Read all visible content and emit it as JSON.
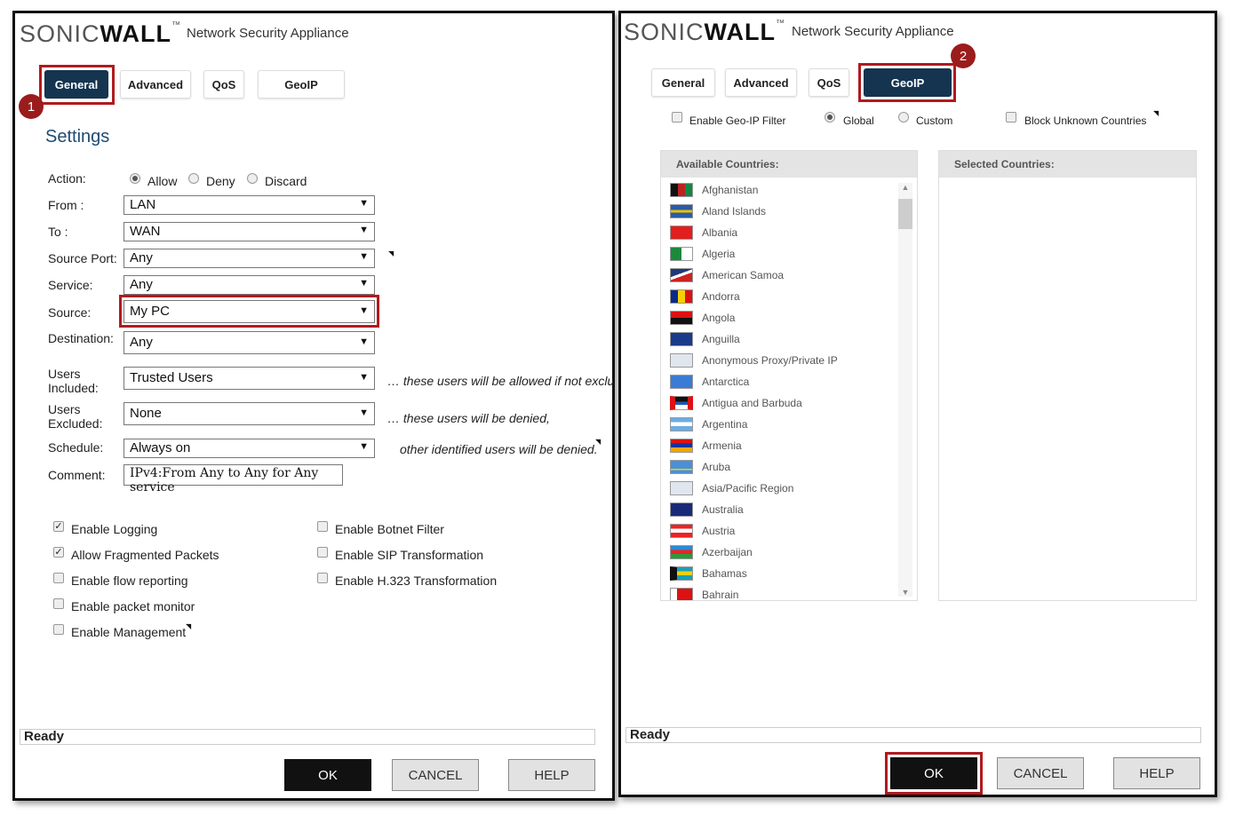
{
  "left": {
    "logo": {
      "sonic": "SONIC",
      "wall": "WALL",
      "tm": "™"
    },
    "app_name": "Network Security Appliance",
    "tabs": [
      "General",
      "Advanced",
      "QoS",
      "GeoIP"
    ],
    "badge": "1",
    "settings_title": "Settings",
    "action_label": "Action:",
    "action_options": [
      "Allow",
      "Deny",
      "Discard"
    ],
    "fields": {
      "from": {
        "label": "From :",
        "value": "LAN"
      },
      "to": {
        "label": "To :",
        "value": "WAN"
      },
      "source_port": {
        "label": "Source Port:",
        "value": "Any"
      },
      "service": {
        "label": "Service:",
        "value": "Any"
      },
      "source": {
        "label": "Source:",
        "value": "My PC"
      },
      "destination": {
        "label": "Destination:",
        "value": "Any"
      },
      "users_included": {
        "label1": "Users",
        "label2": "Included:",
        "value": "Trusted Users",
        "note": "… these users will be allowed if not excluded"
      },
      "users_excluded": {
        "label1": "Users",
        "label2": "Excluded:",
        "value": "None",
        "note": "… these users will be denied,"
      },
      "schedule": {
        "label": "Schedule:",
        "value": "Always on",
        "note": "other identified users will be denied."
      },
      "comment": {
        "label": "Comment:",
        "value": "IPv4:From Any to Any for Any service"
      }
    },
    "checkboxes_left": [
      "Enable Logging",
      "Allow Fragmented Packets",
      "Enable flow reporting",
      "Enable packet monitor",
      "Enable Management"
    ],
    "checkboxes_right": [
      "Enable Botnet Filter",
      "Enable SIP Transformation",
      "Enable H.323 Transformation"
    ],
    "status": "Ready",
    "buttons": {
      "ok": "OK",
      "cancel": "CANCEL",
      "help": "HELP"
    }
  },
  "right": {
    "logo": {
      "sonic": "SONIC",
      "wall": "WALL",
      "tm": "™"
    },
    "app_name": "Network Security Appliance",
    "tabs": [
      "General",
      "Advanced",
      "QoS",
      "GeoIP"
    ],
    "badge": "2",
    "enable_geoip": "Enable Geo-IP Filter",
    "global_label": "Global",
    "custom_label": "Custom",
    "block_unknown": "Block Unknown Countries",
    "available_header": "Available Countries:",
    "selected_header": "Selected Countries:",
    "countries": [
      "Afghanistan",
      "Aland Islands",
      "Albania",
      "Algeria",
      "American Samoa",
      "Andorra",
      "Angola",
      "Anguilla",
      "Anonymous Proxy/Private IP",
      "Antarctica",
      "Antigua and Barbuda",
      "Argentina",
      "Armenia",
      "Aruba",
      "Asia/Pacific Region",
      "Australia",
      "Austria",
      "Azerbaijan",
      "Bahamas",
      "Bahrain"
    ],
    "status": "Ready",
    "buttons": {
      "ok": "OK",
      "cancel": "CANCEL",
      "help": "HELP"
    }
  },
  "colors": {
    "accent": "#15344f",
    "highlight": "#b01a1f",
    "title": "#1e4b72"
  }
}
